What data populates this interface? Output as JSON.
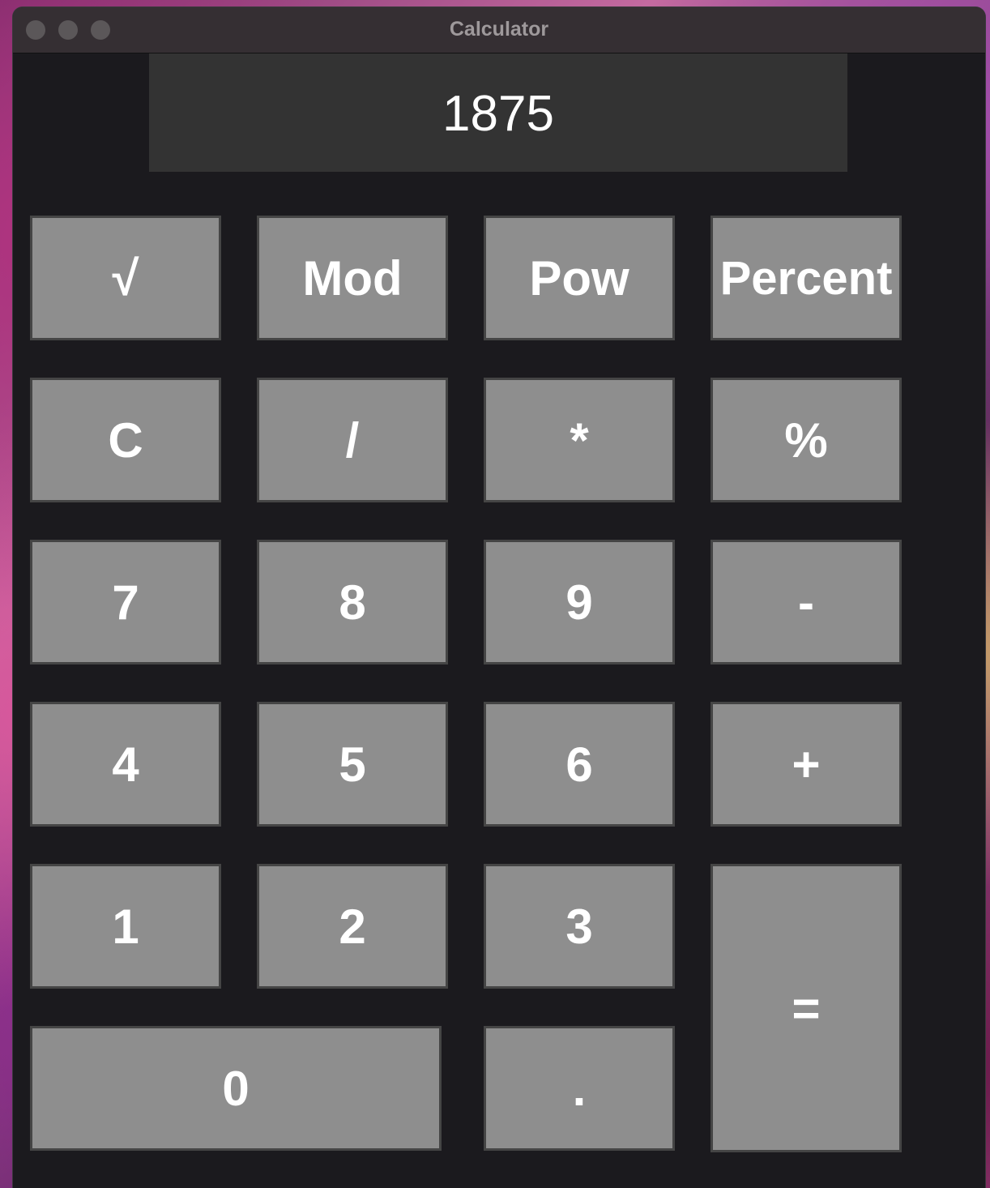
{
  "window": {
    "title": "Calculator"
  },
  "display": {
    "value": "1875"
  },
  "keys": {
    "sqrt": "√",
    "mod": "Mod",
    "pow": "Pow",
    "percent_word": "Percent",
    "clear": "C",
    "divide": "/",
    "multiply": "*",
    "percent_symbol": "%",
    "seven": "7",
    "eight": "8",
    "nine": "9",
    "minus": "-",
    "four": "4",
    "five": "5",
    "six": "6",
    "plus": "+",
    "one": "1",
    "two": "2",
    "three": "3",
    "equals": "=",
    "zero": "0",
    "decimal": "."
  },
  "colors": {
    "window_bg": "#1b1a1e",
    "display_bg": "#333333",
    "key_bg": "#8e8e8e",
    "key_border": "#454545",
    "text": "#ffffff"
  }
}
